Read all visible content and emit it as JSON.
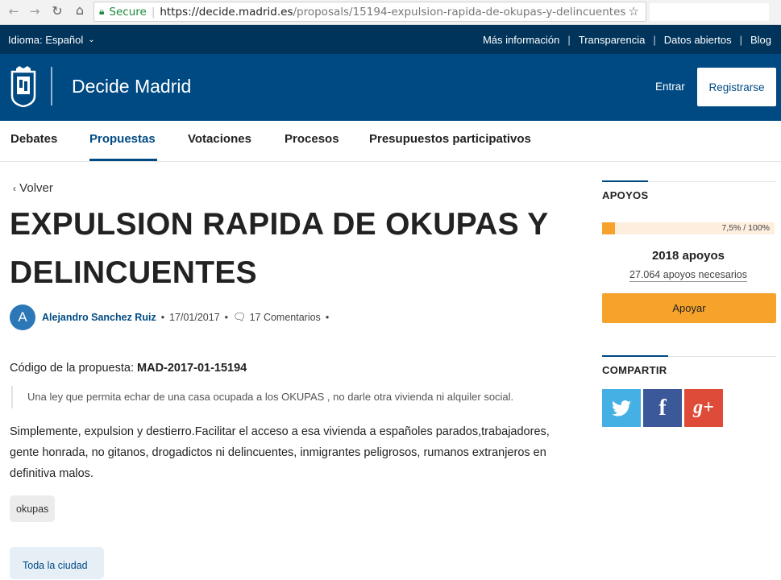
{
  "browser": {
    "secure_label": "Secure",
    "url_host": "https://decide.madrid.es",
    "url_path": "/proposals/15194-expulsion-rapida-de-okupas-y-delincuentes"
  },
  "top_bar": {
    "language_label": "Idioma: Español",
    "links": [
      "Más información",
      "Transparencia",
      "Datos abiertos",
      "Blog"
    ]
  },
  "header": {
    "site_name": "Decide Madrid",
    "login_label": "Entrar",
    "register_label": "Registrarse"
  },
  "nav": {
    "items": [
      "Debates",
      "Propuestas",
      "Votaciones",
      "Procesos",
      "Presupuestos participativos"
    ],
    "active": "Propuestas"
  },
  "proposal": {
    "back_label": "Volver",
    "title": "EXPULSION RAPIDA DE OKUPAS Y DELINCUENTES",
    "author_initial": "A",
    "author": "Alejandro Sanchez Ruiz",
    "date": "17/01/2017",
    "comments": "17 Comentarios",
    "code_label": "Código de la propuesta:",
    "code": "MAD-2017-01-15194",
    "summary": "Una ley que permita echar de una casa ocupada a los OKUPAS , no darle otra vivienda ni alquiler social.",
    "description": "Simplemente, expulsion y destierro.Facilitar el acceso a esa vivienda a españoles parados,trabajadores, gente honrada, no gitanos, drogadictos ni delincuentes, inmigrantes peligrosos, rumanos extranjeros en definitiva malos.",
    "tag": "okupas",
    "geozone": "Toda la ciudad"
  },
  "supports": {
    "heading": "APOYOS",
    "progress_fraction": 0.075,
    "progress_label": "7,5% / 100%",
    "count_label": "2018 apoyos",
    "needed_label": "27.064 apoyos necesarios",
    "button_label": "Apoyar"
  },
  "share": {
    "heading": "COMPARTIR",
    "twitter_icon": "twitter-icon",
    "facebook_icon": "facebook-icon",
    "facebook_glyph": "f",
    "gplus_icon": "google-plus-icon",
    "gplus_glyph": "g+"
  },
  "colors": {
    "top_strip": "#00345b",
    "header": "#004a83",
    "accent_orange": "#f7a32b",
    "twitter": "#45b0e3",
    "facebook": "#3b5998",
    "gplus": "#de4b39"
  }
}
